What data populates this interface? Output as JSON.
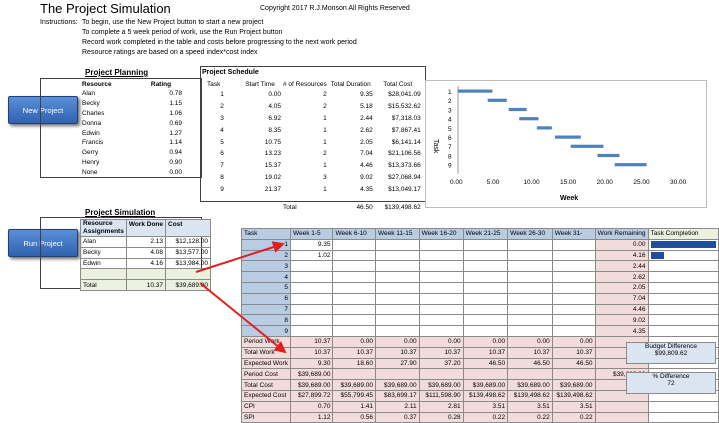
{
  "title": "The Project Simulation",
  "copyright": "Copyright 2017 R.J.Monson All Rights Reserved",
  "instructions": {
    "label": "Instructions:",
    "lines": [
      "To begin, use the New Project button to start a new project",
      "To complete a 5 week period of work, use the Run Project button",
      "Record work completed in the table and costs before progressing to the next work period",
      "Resource ratings are based on a speed index*cost index"
    ]
  },
  "buttons": {
    "new_project": "New Project",
    "run_project": "Run Project"
  },
  "planning": {
    "title": "Project Planning",
    "headers": [
      "Resource",
      "Rating"
    ],
    "rows": [
      [
        "Alan",
        "0.78"
      ],
      [
        "Becky",
        "1.15"
      ],
      [
        "Charles",
        "1.06"
      ],
      [
        "Donna",
        "0.69"
      ],
      [
        "Edwin",
        "1.27"
      ],
      [
        "Francis",
        "1.14"
      ],
      [
        "Gerry",
        "0.94"
      ],
      [
        "Henry",
        "0.90"
      ],
      [
        "None",
        "0.00"
      ]
    ]
  },
  "schedule": {
    "title": "Project Schedule",
    "headers": [
      "Task",
      "Start Time",
      "# of Resources",
      "Total Duration",
      "Total Cost"
    ],
    "rows": [
      [
        "1",
        "0.00",
        "2",
        "9.35",
        "$28,041.09"
      ],
      [
        "2",
        "4.05",
        "2",
        "5.18",
        "$15,532.62"
      ],
      [
        "3",
        "6.92",
        "1",
        "2.44",
        "$7,318.03"
      ],
      [
        "4",
        "8.35",
        "1",
        "2.62",
        "$7,867.41"
      ],
      [
        "5",
        "10.75",
        "1",
        "2.05",
        "$6,141.14"
      ],
      [
        "6",
        "13.23",
        "2",
        "7.04",
        "$21,106.56"
      ],
      [
        "7",
        "15.37",
        "1",
        "4.46",
        "$13,373.66"
      ],
      [
        "8",
        "19.02",
        "3",
        "9.02",
        "$27,068.94"
      ],
      [
        "9",
        "21.37",
        "1",
        "4.35",
        "$13,049.17"
      ]
    ],
    "total_label": "Total",
    "total_duration": "46.50",
    "total_cost": "$139,498.62"
  },
  "chart_data": {
    "type": "bar",
    "categories": [
      "1",
      "2",
      "3",
      "4",
      "5",
      "6",
      "7",
      "8",
      "9"
    ],
    "start": [
      0.0,
      4.05,
      6.92,
      8.35,
      10.75,
      13.23,
      15.37,
      19.02,
      21.37
    ],
    "duration": [
      4.7,
      2.6,
      2.44,
      2.62,
      2.05,
      3.52,
      4.46,
      3.0,
      4.35
    ],
    "xlim": [
      0,
      30
    ],
    "xticks": [
      "0.00",
      "5.00",
      "10.00",
      "15.00",
      "20.00",
      "25.00",
      "30.00"
    ],
    "xlabel": "Week",
    "ylabel": "Task",
    "color": "#4f81bd"
  },
  "simulation": {
    "title": "Project Simulation",
    "headers": [
      "Resource Assignments",
      "Work Done",
      "Cost"
    ],
    "rows": [
      [
        "Alan",
        "2.13",
        "$12,128.00"
      ],
      [
        "Becky",
        "4.08",
        "$13,577.00"
      ],
      [
        "Edwin",
        "4.16",
        "$13,984.00"
      ]
    ],
    "total_label": "Total",
    "total_work": "10.37",
    "total_cost": "$39,689.00"
  },
  "tracking": {
    "headers": [
      "Task",
      "Week 1-5",
      "Week 6-10",
      "Week 11-15",
      "Week 16-20",
      "Week 21-25",
      "Week 26-30",
      "Week 31-",
      "Work Remaining",
      "Task Completion"
    ],
    "tasks": [
      [
        "1",
        "9.35"
      ],
      [
        "2",
        "1.02"
      ],
      [
        "3",
        ""
      ],
      [
        "4",
        ""
      ],
      [
        "5",
        ""
      ],
      [
        "6",
        ""
      ],
      [
        "7",
        ""
      ],
      [
        "8",
        ""
      ],
      [
        "9",
        ""
      ]
    ],
    "remaining": [
      "0.00",
      "4.16",
      "2.44",
      "2.62",
      "2.05",
      "7.04",
      "4.46",
      "9.02",
      "4.35"
    ],
    "completion": [
      1.0,
      0.2,
      0,
      0,
      0,
      0,
      0,
      0,
      0
    ],
    "summary": [
      {
        "label": "Period Work",
        "vals": [
          "10.37",
          "0.00",
          "0.00",
          "0.00",
          "0.00",
          "0.00",
          "0.00"
        ]
      },
      {
        "label": "Total Work",
        "vals": [
          "10.37",
          "10.37",
          "10.37",
          "10.37",
          "10.37",
          "10.37",
          "10.37"
        ]
      },
      {
        "label": "Expected Work",
        "vals": [
          "9.30",
          "18.60",
          "27.90",
          "37.20",
          "46.50",
          "46.50",
          "46.50"
        ]
      },
      {
        "label": "Period Cost",
        "vals": [
          "$39,689.00",
          "",
          "",
          "",
          "",
          "",
          "",
          "$39,689.00"
        ]
      },
      {
        "label": "Total Cost",
        "vals": [
          "$39,689.00",
          "$39,689.00",
          "$39,689.00",
          "$39,689.00",
          "$39,689.00",
          "$39,689.00",
          "$39,689.00"
        ]
      },
      {
        "label": "Expected Cost",
        "vals": [
          "$27,899.72",
          "$55,799.45",
          "$83,699.17",
          "$111,598.90",
          "$139,498.62",
          "$139,498.62",
          "$139,498.62"
        ]
      },
      {
        "label": "CPI",
        "vals": [
          "0.70",
          "1.41",
          "2.11",
          "2.81",
          "3.51",
          "3.51",
          "3.51"
        ]
      },
      {
        "label": "SPI",
        "vals": [
          "1.12",
          "0.56",
          "0.37",
          "0.28",
          "0.22",
          "0.22",
          "0.22"
        ]
      }
    ],
    "budget_label": "Budget Difference",
    "budget_value": "$99,809.62",
    "pct_label": "% Difference",
    "pct_value": "72"
  }
}
